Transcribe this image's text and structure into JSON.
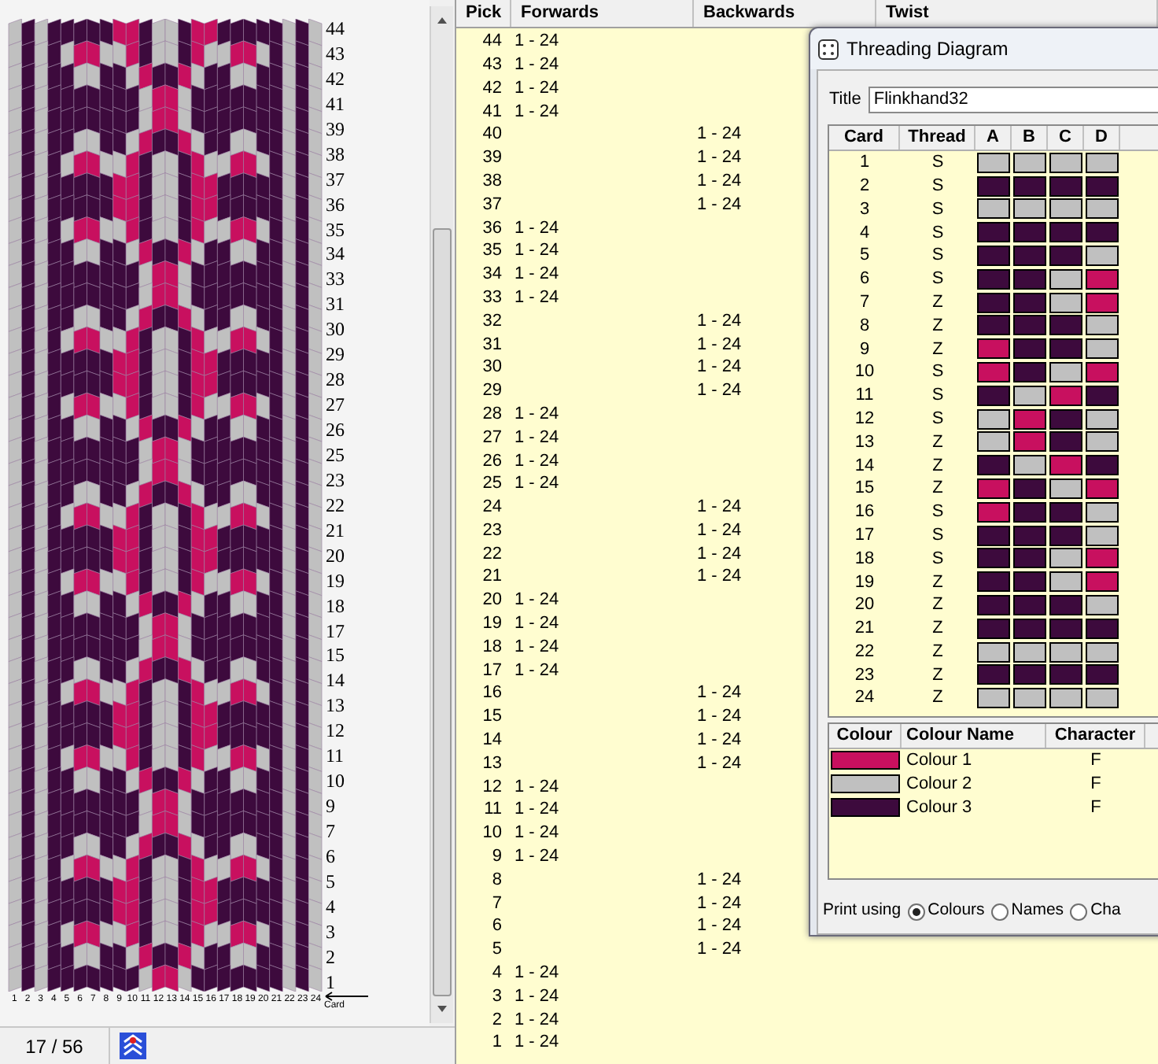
{
  "pattern": {
    "row_labels": [
      "44",
      "43",
      "42",
      "41",
      "39",
      "38",
      "37",
      "36",
      "35",
      "34",
      "33",
      "31",
      "30",
      "29",
      "28",
      "27",
      "26",
      "25",
      "23",
      "22",
      "21",
      "20",
      "19",
      "18",
      "17",
      "15",
      "14",
      "13",
      "12",
      "11",
      "10",
      "9",
      "7",
      "6",
      "5",
      "4",
      "3",
      "2",
      "1"
    ],
    "column_labels": [
      "1",
      "2",
      "3",
      "4",
      "5",
      "6",
      "7",
      "8",
      "9",
      "10",
      "11",
      "12",
      "13",
      "14",
      "15",
      "16",
      "17",
      "18",
      "19",
      "20",
      "21",
      "22",
      "23",
      "24"
    ],
    "axis_label": "Card"
  },
  "status_bar": {
    "position": "17 / 56"
  },
  "pick_table": {
    "columns": [
      "Pick",
      "Forwards",
      "Backwards",
      "Twist"
    ],
    "rows": [
      {
        "pick": "44",
        "kind": "forwards",
        "cards": "1 - 24"
      },
      {
        "pick": "43",
        "kind": "forwards",
        "cards": "1 - 24"
      },
      {
        "pick": "42",
        "kind": "forwards",
        "cards": "1 - 24"
      },
      {
        "pick": "41",
        "kind": "forwards",
        "cards": "1 - 24"
      },
      {
        "pick": "40",
        "kind": "backwards",
        "cards": "1 - 24"
      },
      {
        "pick": "39",
        "kind": "backwards",
        "cards": "1 - 24"
      },
      {
        "pick": "38",
        "kind": "backwards",
        "cards": "1 - 24"
      },
      {
        "pick": "37",
        "kind": "backwards",
        "cards": "1 - 24"
      },
      {
        "pick": "36",
        "kind": "forwards",
        "cards": "1 - 24"
      },
      {
        "pick": "35",
        "kind": "forwards",
        "cards": "1 - 24"
      },
      {
        "pick": "34",
        "kind": "forwards",
        "cards": "1 - 24"
      },
      {
        "pick": "33",
        "kind": "forwards",
        "cards": "1 - 24"
      },
      {
        "pick": "32",
        "kind": "backwards",
        "cards": "1 - 24"
      },
      {
        "pick": "31",
        "kind": "backwards",
        "cards": "1 - 24"
      },
      {
        "pick": "30",
        "kind": "backwards",
        "cards": "1 - 24"
      },
      {
        "pick": "29",
        "kind": "backwards",
        "cards": "1 - 24"
      },
      {
        "pick": "28",
        "kind": "forwards",
        "cards": "1 - 24"
      },
      {
        "pick": "27",
        "kind": "forwards",
        "cards": "1 - 24"
      },
      {
        "pick": "26",
        "kind": "forwards",
        "cards": "1 - 24"
      },
      {
        "pick": "25",
        "kind": "forwards",
        "cards": "1 - 24"
      },
      {
        "pick": "24",
        "kind": "backwards",
        "cards": "1 - 24"
      },
      {
        "pick": "23",
        "kind": "backwards",
        "cards": "1 - 24"
      },
      {
        "pick": "22",
        "kind": "backwards",
        "cards": "1 - 24"
      },
      {
        "pick": "21",
        "kind": "backwards",
        "cards": "1 - 24"
      },
      {
        "pick": "20",
        "kind": "forwards",
        "cards": "1 - 24"
      },
      {
        "pick": "19",
        "kind": "forwards",
        "cards": "1 - 24"
      },
      {
        "pick": "18",
        "kind": "forwards",
        "cards": "1 - 24"
      },
      {
        "pick": "17",
        "kind": "forwards",
        "cards": "1 - 24"
      },
      {
        "pick": "16",
        "kind": "backwards",
        "cards": "1 - 24"
      },
      {
        "pick": "15",
        "kind": "backwards",
        "cards": "1 - 24"
      },
      {
        "pick": "14",
        "kind": "backwards",
        "cards": "1 - 24"
      },
      {
        "pick": "13",
        "kind": "backwards",
        "cards": "1 - 24"
      },
      {
        "pick": "12",
        "kind": "forwards",
        "cards": "1 - 24"
      },
      {
        "pick": "11",
        "kind": "forwards",
        "cards": "1 - 24"
      },
      {
        "pick": "10",
        "kind": "forwards",
        "cards": "1 - 24"
      },
      {
        "pick": "9",
        "kind": "forwards",
        "cards": "1 - 24"
      },
      {
        "pick": "8",
        "kind": "backwards",
        "cards": "1 - 24"
      },
      {
        "pick": "7",
        "kind": "backwards",
        "cards": "1 - 24"
      },
      {
        "pick": "6",
        "kind": "backwards",
        "cards": "1 - 24"
      },
      {
        "pick": "5",
        "kind": "backwards",
        "cards": "1 - 24"
      },
      {
        "pick": "4",
        "kind": "forwards",
        "cards": "1 - 24"
      },
      {
        "pick": "3",
        "kind": "forwards",
        "cards": "1 - 24"
      },
      {
        "pick": "2",
        "kind": "forwards",
        "cards": "1 - 24"
      },
      {
        "pick": "1",
        "kind": "forwards",
        "cards": "1 - 24"
      }
    ]
  },
  "threading_dialog": {
    "window_title": "Threading Diagram",
    "title_label": "Title",
    "title_value": "Flinkhand32",
    "card_columns": [
      "Card",
      "Thread",
      "A",
      "B",
      "C",
      "D"
    ],
    "cards": [
      {
        "card": "1",
        "thread": "S",
        "holes": [
          {
            "color": "#c0c0c0"
          },
          {
            "color": "#c0c0c0"
          },
          {
            "color": "#c0c0c0"
          },
          {
            "color": "#c0c0c0"
          }
        ]
      },
      {
        "card": "2",
        "thread": "S",
        "holes": [
          {
            "color": "#3d0a3d"
          },
          {
            "color": "#3d0a3d"
          },
          {
            "color": "#3d0a3d"
          },
          {
            "color": "#3d0a3d"
          }
        ]
      },
      {
        "card": "3",
        "thread": "S",
        "holes": [
          {
            "color": "#c0c0c0"
          },
          {
            "color": "#c0c0c0"
          },
          {
            "color": "#c0c0c0"
          },
          {
            "color": "#c0c0c0"
          }
        ]
      },
      {
        "card": "4",
        "thread": "S",
        "holes": [
          {
            "color": "#3d0a3d"
          },
          {
            "color": "#3d0a3d"
          },
          {
            "color": "#3d0a3d"
          },
          {
            "color": "#3d0a3d"
          }
        ]
      },
      {
        "card": "5",
        "thread": "S",
        "holes": [
          {
            "color": "#3d0a3d"
          },
          {
            "color": "#3d0a3d"
          },
          {
            "color": "#3d0a3d"
          },
          {
            "color": "#c0c0c0"
          }
        ]
      },
      {
        "card": "6",
        "thread": "S",
        "holes": [
          {
            "color": "#3d0a3d"
          },
          {
            "color": "#3d0a3d"
          },
          {
            "color": "#c0c0c0"
          },
          {
            "color": "#c8105f"
          }
        ]
      },
      {
        "card": "7",
        "thread": "Z",
        "holes": [
          {
            "color": "#3d0a3d"
          },
          {
            "color": "#3d0a3d"
          },
          {
            "color": "#c0c0c0"
          },
          {
            "color": "#c8105f"
          }
        ]
      },
      {
        "card": "8",
        "thread": "Z",
        "holes": [
          {
            "color": "#3d0a3d"
          },
          {
            "color": "#3d0a3d"
          },
          {
            "color": "#3d0a3d"
          },
          {
            "color": "#c0c0c0"
          }
        ]
      },
      {
        "card": "9",
        "thread": "Z",
        "holes": [
          {
            "color": "#c8105f"
          },
          {
            "color": "#3d0a3d"
          },
          {
            "color": "#3d0a3d"
          },
          {
            "color": "#c0c0c0"
          }
        ]
      },
      {
        "card": "10",
        "thread": "S",
        "holes": [
          {
            "color": "#c8105f"
          },
          {
            "color": "#3d0a3d"
          },
          {
            "color": "#c0c0c0"
          },
          {
            "color": "#c8105f"
          }
        ]
      },
      {
        "card": "11",
        "thread": "S",
        "holes": [
          {
            "color": "#3d0a3d"
          },
          {
            "color": "#c0c0c0"
          },
          {
            "color": "#c8105f"
          },
          {
            "color": "#3d0a3d"
          }
        ]
      },
      {
        "card": "12",
        "thread": "S",
        "holes": [
          {
            "color": "#c0c0c0"
          },
          {
            "color": "#c8105f"
          },
          {
            "color": "#3d0a3d"
          },
          {
            "color": "#c0c0c0"
          }
        ]
      },
      {
        "card": "13",
        "thread": "Z",
        "holes": [
          {
            "color": "#c0c0c0"
          },
          {
            "color": "#c8105f"
          },
          {
            "color": "#3d0a3d"
          },
          {
            "color": "#c0c0c0"
          }
        ]
      },
      {
        "card": "14",
        "thread": "Z",
        "holes": [
          {
            "color": "#3d0a3d"
          },
          {
            "color": "#c0c0c0"
          },
          {
            "color": "#c8105f"
          },
          {
            "color": "#3d0a3d"
          }
        ]
      },
      {
        "card": "15",
        "thread": "Z",
        "holes": [
          {
            "color": "#c8105f"
          },
          {
            "color": "#3d0a3d"
          },
          {
            "color": "#c0c0c0"
          },
          {
            "color": "#c8105f"
          }
        ]
      },
      {
        "card": "16",
        "thread": "S",
        "holes": [
          {
            "color": "#c8105f"
          },
          {
            "color": "#3d0a3d"
          },
          {
            "color": "#3d0a3d"
          },
          {
            "color": "#c0c0c0"
          }
        ]
      },
      {
        "card": "17",
        "thread": "S",
        "holes": [
          {
            "color": "#3d0a3d"
          },
          {
            "color": "#3d0a3d"
          },
          {
            "color": "#3d0a3d"
          },
          {
            "color": "#c0c0c0"
          }
        ]
      },
      {
        "card": "18",
        "thread": "S",
        "holes": [
          {
            "color": "#3d0a3d"
          },
          {
            "color": "#3d0a3d"
          },
          {
            "color": "#c0c0c0"
          },
          {
            "color": "#c8105f"
          }
        ]
      },
      {
        "card": "19",
        "thread": "Z",
        "holes": [
          {
            "color": "#3d0a3d"
          },
          {
            "color": "#3d0a3d"
          },
          {
            "color": "#c0c0c0"
          },
          {
            "color": "#c8105f"
          }
        ]
      },
      {
        "card": "20",
        "thread": "Z",
        "holes": [
          {
            "color": "#3d0a3d"
          },
          {
            "color": "#3d0a3d"
          },
          {
            "color": "#3d0a3d"
          },
          {
            "color": "#c0c0c0"
          }
        ]
      },
      {
        "card": "21",
        "thread": "Z",
        "holes": [
          {
            "color": "#3d0a3d"
          },
          {
            "color": "#3d0a3d"
          },
          {
            "color": "#3d0a3d"
          },
          {
            "color": "#3d0a3d"
          }
        ]
      },
      {
        "card": "22",
        "thread": "Z",
        "holes": [
          {
            "color": "#c0c0c0"
          },
          {
            "color": "#c0c0c0"
          },
          {
            "color": "#c0c0c0"
          },
          {
            "color": "#c0c0c0"
          }
        ]
      },
      {
        "card": "23",
        "thread": "Z",
        "holes": [
          {
            "color": "#3d0a3d"
          },
          {
            "color": "#3d0a3d"
          },
          {
            "color": "#3d0a3d"
          },
          {
            "color": "#3d0a3d"
          }
        ]
      },
      {
        "card": "24",
        "thread": "Z",
        "holes": [
          {
            "color": "#c0c0c0"
          },
          {
            "color": "#c0c0c0"
          },
          {
            "color": "#c0c0c0"
          },
          {
            "color": "#c0c0c0"
          }
        ]
      }
    ],
    "colour_columns": [
      "Colour",
      "Colour Name",
      "Character"
    ],
    "colours": [
      {
        "color": "#c8105f",
        "name": "Colour 1",
        "character": "F"
      },
      {
        "color": "#c0c0c0",
        "name": "Colour 2",
        "character": "F"
      },
      {
        "color": "#3d0a3d",
        "name": "Colour 3",
        "character": "F"
      }
    ],
    "print_label": "Print using",
    "print_options": [
      {
        "label": "Colours",
        "selected": true
      },
      {
        "label": "Names",
        "selected": false
      },
      {
        "label": "Cha",
        "selected": false
      }
    ]
  }
}
